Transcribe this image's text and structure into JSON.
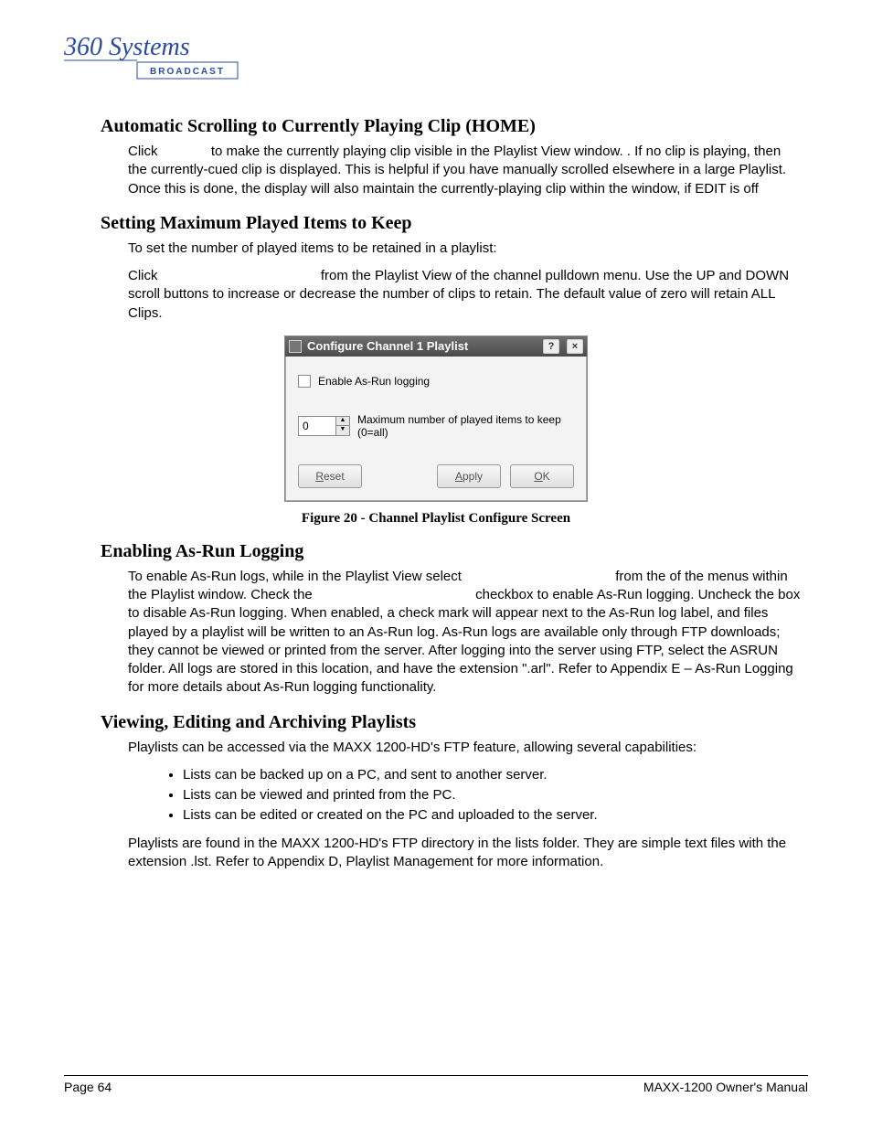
{
  "logo": {
    "brand_top": "360 Systems",
    "brand_bottom": "BROADCAST"
  },
  "sections": {
    "s1": {
      "heading": "Automatic Scrolling to Currently Playing Clip (HOME)",
      "p1_a": "Click ",
      "p1_b": " to make the currently playing clip visible in the Playlist View window. .  If no clip is playing, then the currently-cued clip is displayed. This is helpful if you have manually scrolled elsewhere in a large Playlist. Once this is done, the display will also maintain the currently-playing clip within the window, if EDIT is off"
    },
    "s2": {
      "heading": "Setting Maximum Played Items to Keep",
      "p1": "To set the number of played items to be retained in a playlist:",
      "p2_a": "Click ",
      "p2_b": " from the Playlist View of the channel pulldown menu. Use the UP and DOWN scroll buttons to increase or decrease the number of clips to retain. The default value of zero will retain ALL Clips."
    },
    "dialog": {
      "title": "Configure Channel 1 Playlist",
      "help_btn": "?",
      "close_btn": "×",
      "checkbox_label": "Enable As-Run logging",
      "spinner_value": "0",
      "spinner_label": "Maximum number of played items to keep (0=all)",
      "reset_btn": "Reset",
      "reset_u": "R",
      "apply_btn": "Apply",
      "apply_u": "A",
      "ok_btn": "OK",
      "ok_u": "O"
    },
    "caption": "Figure 20 - Channel Playlist Configure Screen",
    "s3": {
      "heading": "Enabling As-Run Logging",
      "p1_a": "To enable As-Run logs, while in the Playlist View select ",
      "p1_b": " from the of the menus within the Playlist window. Check the ",
      "p1_c": " checkbox to enable As-Run logging. Uncheck the box to disable As-Run logging.  When enabled, a check mark will appear next to the As-Run log label, and files played by a playlist will be written to an As-Run log. As-Run logs are available only through FTP downloads; they cannot be viewed or printed from the server.  After logging into the server using FTP, select the ASRUN folder.  All logs are stored in this location, and have the extension \".arl\". Refer to Appendix E – As-Run Logging for more details about As-Run logging functionality."
    },
    "s4": {
      "heading": "Viewing, Editing and Archiving Playlists",
      "p1": "Playlists can be accessed via the MAXX 1200-HD's FTP feature, allowing several capabilities:",
      "bullets": [
        "Lists can be backed up on a PC, and sent to another server.",
        "Lists can be viewed and printed from the PC.",
        "Lists can be edited or created on the PC and uploaded to the server."
      ],
      "p2": "Playlists are found in the MAXX 1200-HD's FTP directory in the lists folder.  They are simple text files with the extension .lst. Refer to Appendix D, Playlist Management for more information."
    }
  },
  "footer": {
    "left": "Page 64",
    "right": "MAXX-1200 Owner's Manual"
  }
}
